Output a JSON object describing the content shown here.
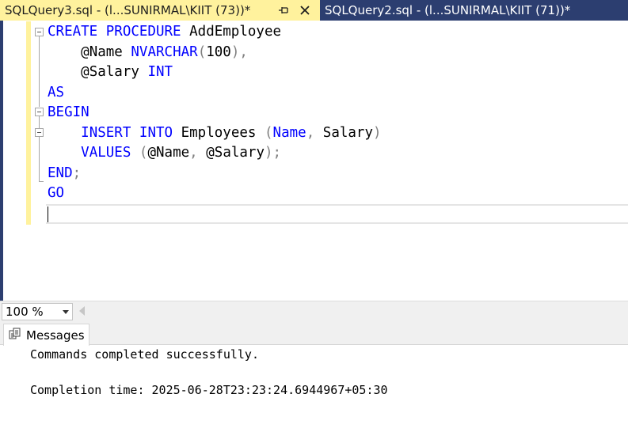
{
  "tabs": [
    {
      "title": "SQLQuery3.sql - (l...SUNIRMAL\\KIIT (73))*",
      "active": true
    },
    {
      "title": "SQLQuery2.sql - (l...SUNIRMAL\\KIIT (71))*",
      "active": false
    }
  ],
  "icons": {
    "pin": "pin-icon",
    "close": "close-icon",
    "messages": "messages-icon",
    "dropdown": "chevron-down-icon"
  },
  "colors": {
    "active_tab": "#fff29d",
    "inactive_tab": "#2c3e70",
    "keyword": "#0000ff",
    "function": "#ff00ff",
    "operator": "#808080"
  },
  "editor": {
    "l1": {
      "kw": "CREATE PROCEDURE",
      "name": "AddEmployee"
    },
    "l2": {
      "param": "@Name",
      "type": "NVARCHAR",
      "open": "(",
      "num": "100",
      "close": "),"
    },
    "l3": {
      "param": "@Salary",
      "type": "INT"
    },
    "l4": {
      "kw": "AS"
    },
    "l5": {
      "kw": "BEGIN"
    },
    "l6": {
      "kw": "INSERT INTO",
      "table": "Employees",
      "open": "(",
      "col1": "Name",
      "comma": ",",
      "col2": "Salary",
      "close": ")"
    },
    "l7": {
      "kw": "VALUES",
      "open": "(",
      "p1": "@Name",
      "comma": ",",
      "p2": "@Salary",
      "close": ");"
    },
    "l8": {
      "kw": "END",
      "semi": ";"
    },
    "l9": {
      "kw": "GO"
    }
  },
  "zoom": {
    "value": "100 %"
  },
  "messages": {
    "tab_label": "Messages",
    "line1": "Commands completed successfully.",
    "line2": "Completion time: 2025-06-28T23:23:24.6944967+05:30"
  }
}
